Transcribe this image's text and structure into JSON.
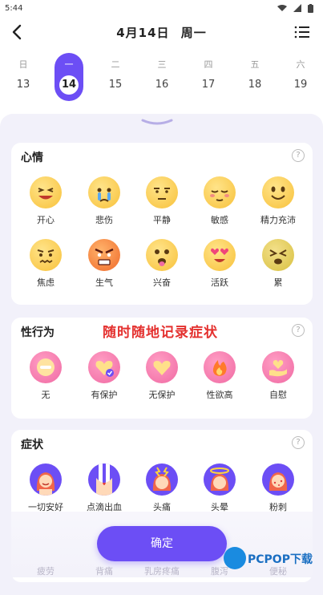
{
  "status": {
    "time": "5:44"
  },
  "header": {
    "date": "4月14日",
    "weekday": "周一"
  },
  "week": [
    {
      "wd": "日",
      "dn": "13"
    },
    {
      "wd": "一",
      "dn": "14",
      "selected": true
    },
    {
      "wd": "二",
      "dn": "15"
    },
    {
      "wd": "三",
      "dn": "16"
    },
    {
      "wd": "四",
      "dn": "17"
    },
    {
      "wd": "五",
      "dn": "18"
    },
    {
      "wd": "六",
      "dn": "19"
    }
  ],
  "mood": {
    "title": "心情",
    "items": [
      "开心",
      "悲伤",
      "平静",
      "敏感",
      "精力充沛",
      "焦虑",
      "生气",
      "兴奋",
      "活跃",
      "累"
    ]
  },
  "sex": {
    "title": "性行为",
    "items": [
      "无",
      "有保护",
      "无保护",
      "性欲高",
      "自慰"
    ]
  },
  "symptoms": {
    "title": "症状",
    "items": [
      "一切安好",
      "点滴出血",
      "头痛",
      "头晕",
      "粉刺"
    ],
    "hidden_row": [
      "疲劳",
      "背痛",
      "乳房疼痛",
      "腹泻",
      "便秘"
    ]
  },
  "overlay_text": "随时随地记录症状",
  "confirm_label": "确定",
  "help_glyph": "?",
  "watermark": {
    "brand": "PCPOP下载"
  },
  "colors": {
    "accent": "#6c4ef5",
    "mood_face": "#f8c13a",
    "sex_icon": "#f06aa3"
  }
}
